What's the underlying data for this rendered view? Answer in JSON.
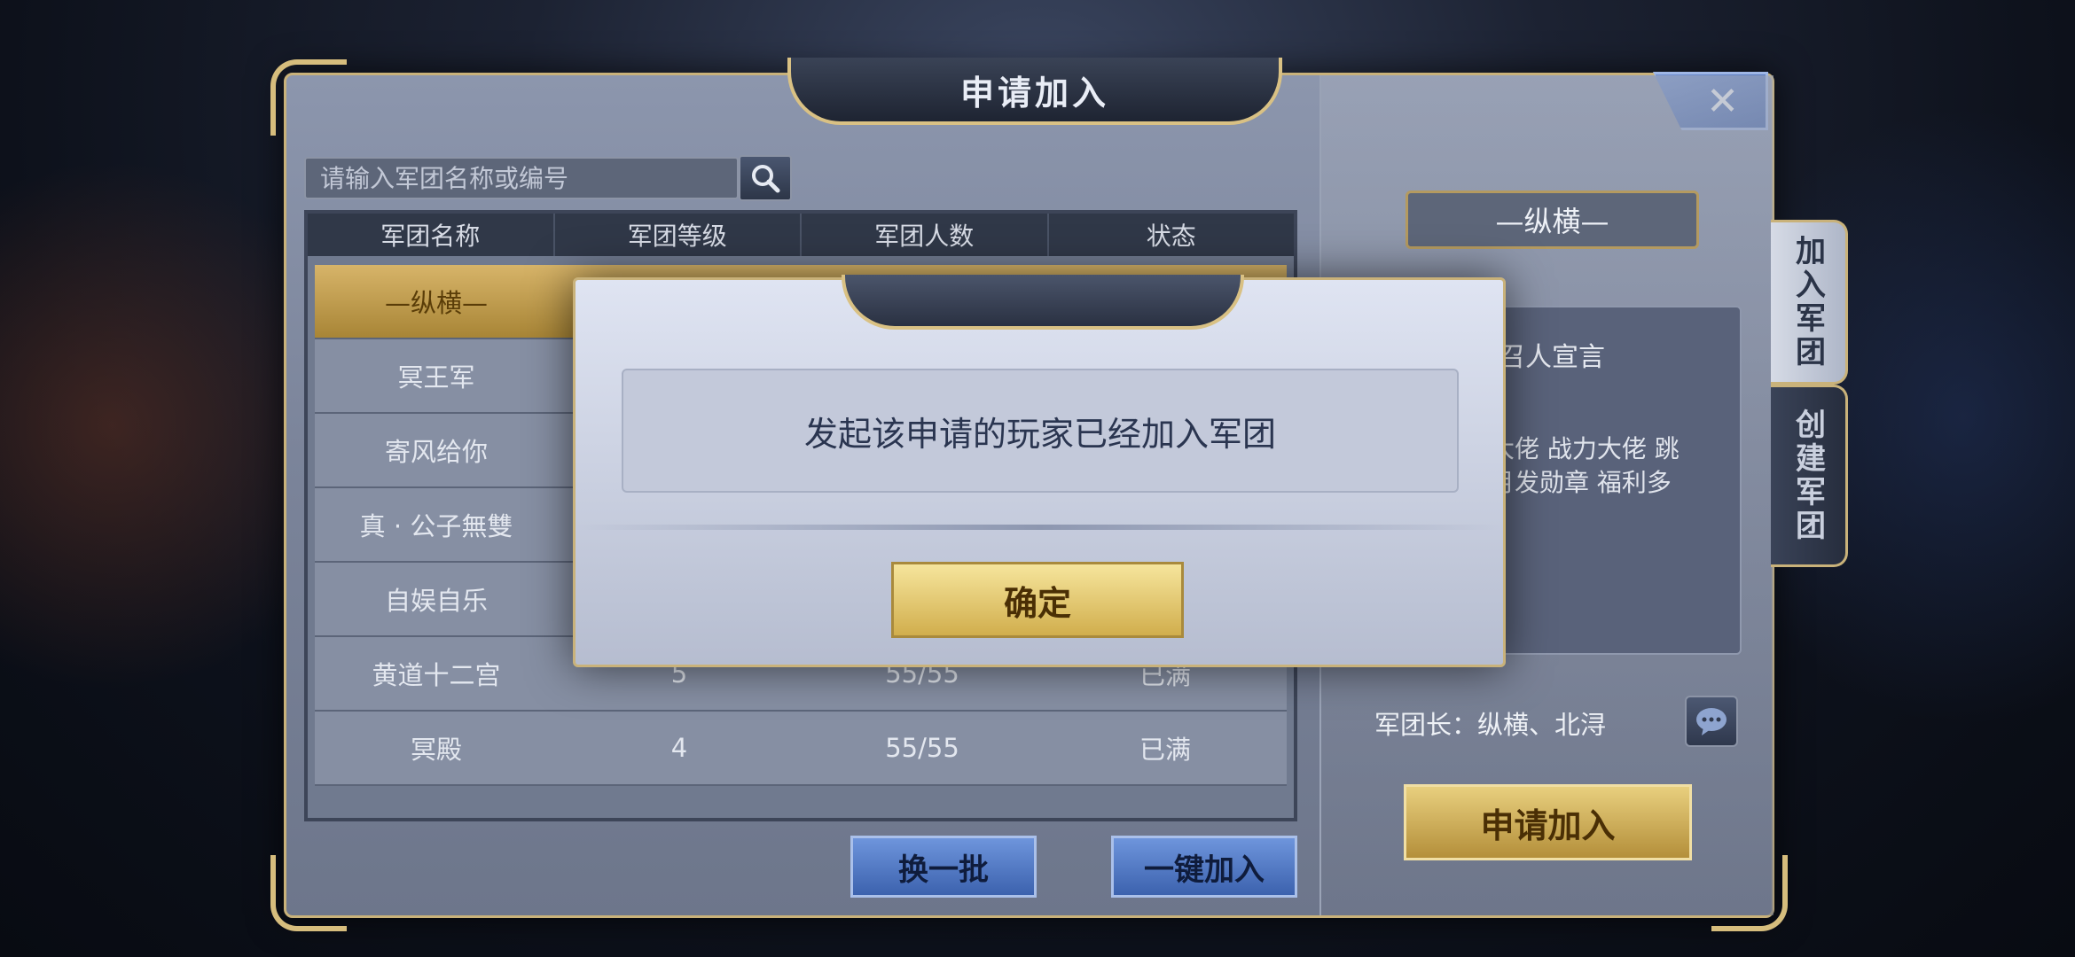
{
  "window": {
    "title": "申请加入",
    "close_label": "✕"
  },
  "search": {
    "placeholder": "请输入军团名称或编号"
  },
  "table": {
    "headers": [
      "军团名称",
      "军团等级",
      "军团人数",
      "状态"
    ],
    "rows": [
      {
        "name": "—纵横—",
        "level": "",
        "members": "",
        "status": ""
      },
      {
        "name": "冥王军",
        "level": "",
        "members": "",
        "status": ""
      },
      {
        "name": "寄风给你",
        "level": "",
        "members": "",
        "status": ""
      },
      {
        "name": "真 · 公子無雙",
        "level": "",
        "members": "",
        "status": ""
      },
      {
        "name": "自娱自乐",
        "level": "",
        "members": "",
        "status": ""
      },
      {
        "name": "黄道十二宫",
        "level": "5",
        "members": "55/55",
        "status": "已满"
      },
      {
        "name": "冥殿",
        "level": "4",
        "members": "55/55",
        "status": "已满"
      }
    ]
  },
  "buttons": {
    "refresh": "换一批",
    "quick_join": "一键加入",
    "apply": "申请加入"
  },
  "detail": {
    "legion_name": "—纵横—",
    "declaration_title": "召人宣言",
    "declaration_text": "大佬 战力大佬 跳\n月发勋章 福利多",
    "leader": "军团长：纵横、北浔"
  },
  "side_tabs": {
    "join": "加入军团",
    "create": "创建军团"
  },
  "modal": {
    "message": "发起该申请的玩家已经加入军团",
    "confirm": "确定"
  }
}
